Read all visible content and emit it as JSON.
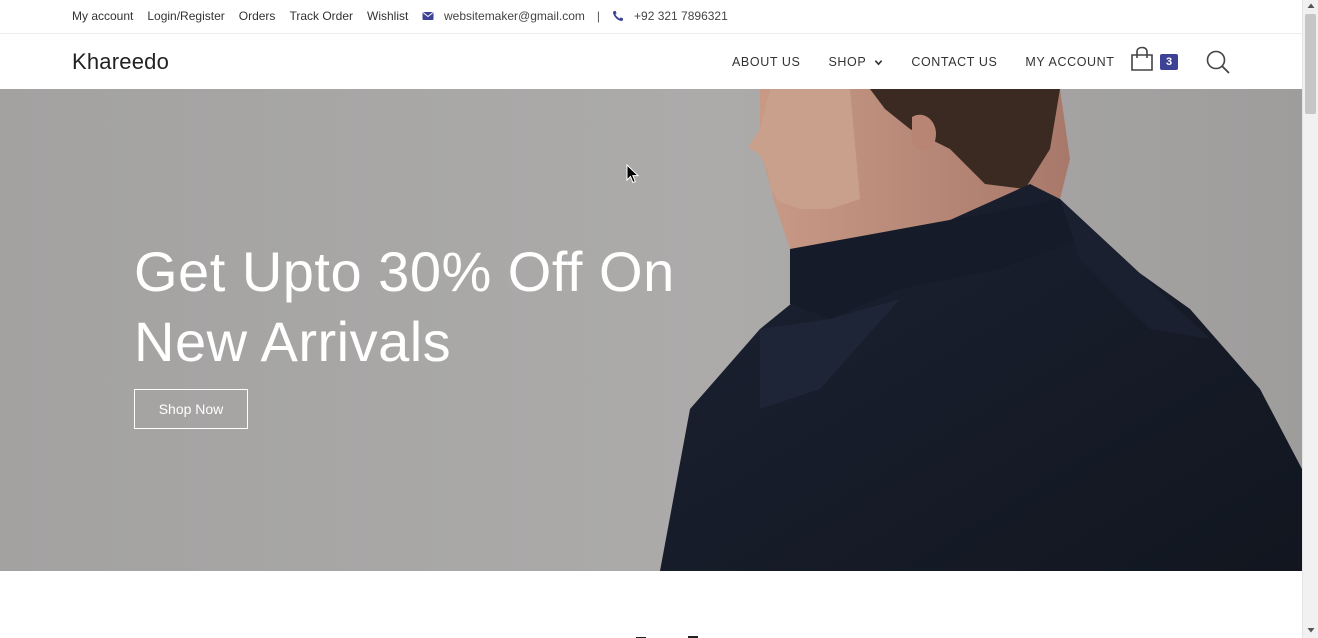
{
  "topbar": {
    "links": [
      "My account",
      "Login/Register",
      "Orders",
      "Track Order",
      "Wishlist"
    ],
    "email": "websitemaker@gmail.com",
    "separator": "|",
    "phone": "+92 321 7896321",
    "icon_color": "#3d4296"
  },
  "header": {
    "brand": "Khareedo",
    "nav": {
      "about": "ABOUT US",
      "shop": "SHOP",
      "contact": "CONTACT US",
      "account": "MY ACCOUNT"
    },
    "cart_count": "3",
    "badge_color": "#3d4296"
  },
  "hero": {
    "title_line1": "Get Upto 30% Off On",
    "title_line2": "New Arrivals",
    "button": "Shop Now",
    "background_color": "#a7a6a5"
  }
}
